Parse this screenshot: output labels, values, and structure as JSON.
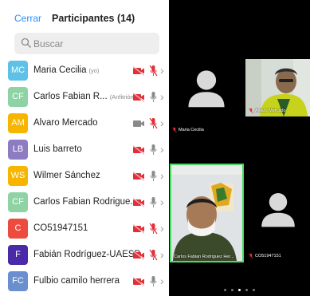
{
  "header": {
    "close_label": "Cerrar",
    "title": "Participantes (14)"
  },
  "search": {
    "placeholder": "Buscar"
  },
  "participants": [
    {
      "initials": "MC",
      "name": "Maria Cecilia",
      "tag": "(yo)",
      "color": "#5ec1e8",
      "video": "off",
      "mic": "muted"
    },
    {
      "initials": "CF",
      "name": "Carlos Fabian R...",
      "tag": "(Anfitrión)",
      "color": "#8fd3a5",
      "video": "off",
      "mic": "on"
    },
    {
      "initials": "AM",
      "name": "Alvaro Mercado",
      "tag": "",
      "color": "#f7b500",
      "video": "on",
      "mic": "muted"
    },
    {
      "initials": "LB",
      "name": "Luis barreto",
      "tag": "",
      "color": "#8e7cc3",
      "video": "off",
      "mic": "on"
    },
    {
      "initials": "WS",
      "name": "Wilmer Sánchez",
      "tag": "",
      "color": "#f7b500",
      "video": "off",
      "mic": "on"
    },
    {
      "initials": "CF",
      "name": "Carlos Fabian Rodrigue...",
      "tag": "",
      "color": "#8fd3a5",
      "video": "off",
      "mic": "on"
    },
    {
      "initials": "C",
      "name": "CO51947151",
      "tag": "",
      "color": "#ee4b3f",
      "video": "off",
      "mic": "muted"
    },
    {
      "initials": "F",
      "name": "Fabián Rodríguez-UAESP",
      "tag": "",
      "color": "#4a2aa6",
      "video": "off",
      "mic": "muted"
    },
    {
      "initials": "FC",
      "name": "Fulbio camilo herrera",
      "tag": "",
      "color": "#6a8fcf",
      "video": "off",
      "mic": "on"
    }
  ],
  "gallery": {
    "tiles": [
      {
        "label": "Maria Cecilia",
        "muted": true,
        "has_video": false
      },
      {
        "label": "Alvaro Mercado",
        "muted": true,
        "has_video": true
      },
      {
        "label": "Carlos Fabian Rodriguez Her...",
        "muted": false,
        "has_video": true,
        "active_speaker": true
      },
      {
        "label": "CO51947151",
        "muted": true,
        "has_video": false
      }
    ],
    "pages": 5,
    "active_page": 2
  },
  "colors": {
    "accent": "#2d8cff",
    "muted_red": "#e0303a",
    "speaker_border": "#4cd964"
  },
  "icons": {
    "search": "magnifier",
    "video_off": "video-off-icon",
    "video_on": "video-on-icon",
    "mic_on": "mic-icon",
    "mic_muted": "mic-muted-icon",
    "chevron": "chevron-right-icon"
  }
}
